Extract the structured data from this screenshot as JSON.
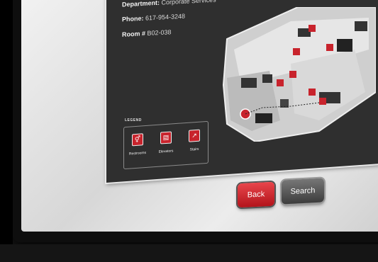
{
  "info": {
    "department_label": "Department:",
    "department_value": "Corporate Services",
    "phone_label": "Phone:",
    "phone_value": "617-954-3248",
    "room_label": "Room #",
    "room_value": "B02-038"
  },
  "legend": {
    "title": "LEGEND",
    "items": [
      {
        "label": "Restrooms",
        "icon": "restroom-icon"
      },
      {
        "label": "Elevators",
        "icon": "elevator-icon"
      },
      {
        "label": "Stairs",
        "icon": "stairs-icon"
      }
    ]
  },
  "buttons": {
    "back_label": "Back",
    "search_label": "Search"
  },
  "colors": {
    "accent": "#c8232c",
    "screen_bg": "#2f2f2f",
    "search_button": "#555555"
  }
}
